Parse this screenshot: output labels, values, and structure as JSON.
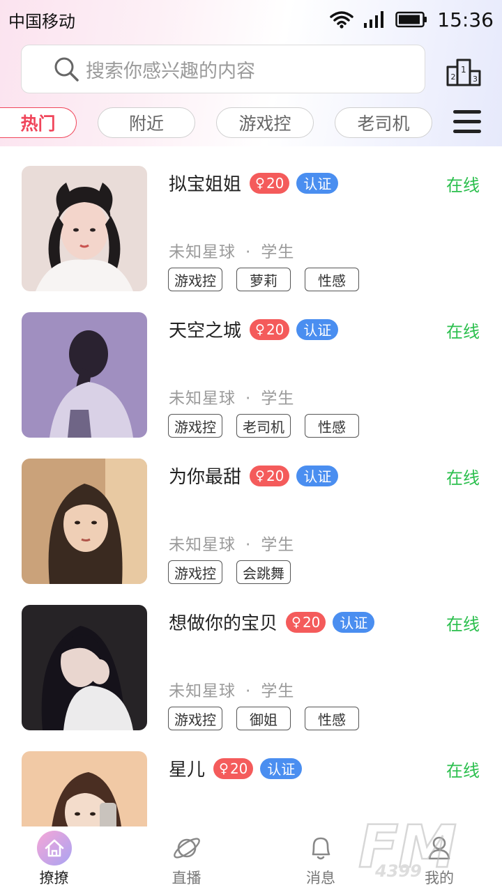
{
  "status_bar": {
    "carrier": "中国移动",
    "time": "15:36"
  },
  "search": {
    "placeholder": "搜索你感兴趣的内容"
  },
  "tabs": [
    {
      "label": "热门",
      "active": true
    },
    {
      "label": "附近"
    },
    {
      "label": "游戏控"
    },
    {
      "label": "老司机"
    }
  ],
  "users": [
    {
      "name": "拟宝姐姐",
      "age": "20",
      "verified": "认证",
      "status": "在线",
      "location": "未知星球",
      "separator": "·",
      "occupation": "学生",
      "tags": [
        "游戏控",
        "萝莉",
        "性感"
      ]
    },
    {
      "name": "天空之城",
      "age": "20",
      "verified": "认证",
      "status": "在线",
      "location": "未知星球",
      "separator": "·",
      "occupation": "学生",
      "tags": [
        "游戏控",
        "老司机",
        "性感"
      ]
    },
    {
      "name": "为你最甜",
      "age": "20",
      "verified": "认证",
      "status": "在线",
      "location": "未知星球",
      "separator": "·",
      "occupation": "学生",
      "tags": [
        "游戏控",
        "会跳舞"
      ]
    },
    {
      "name": "想做你的宝贝",
      "age": "20",
      "verified": "认证",
      "status": "在线",
      "location": "未知星球",
      "separator": "·",
      "occupation": "学生",
      "tags": [
        "游戏控",
        "御姐",
        "性感"
      ]
    },
    {
      "name": "星儿",
      "age": "20",
      "verified": "认证",
      "status": "在线"
    }
  ],
  "bottom_nav": [
    {
      "label": "撩撩",
      "icon": "home-icon",
      "active": true
    },
    {
      "label": "直播",
      "icon": "planet-icon"
    },
    {
      "label": "消息",
      "icon": "bell-icon"
    },
    {
      "label": "我的",
      "icon": "profile-icon"
    }
  ],
  "watermark": {
    "text": "FM",
    "subtext": "4399"
  },
  "colors": {
    "accent": "#f0455a",
    "online": "#2bbf4d",
    "verify": "#4a8ef0",
    "gender": "#f45b5b"
  }
}
